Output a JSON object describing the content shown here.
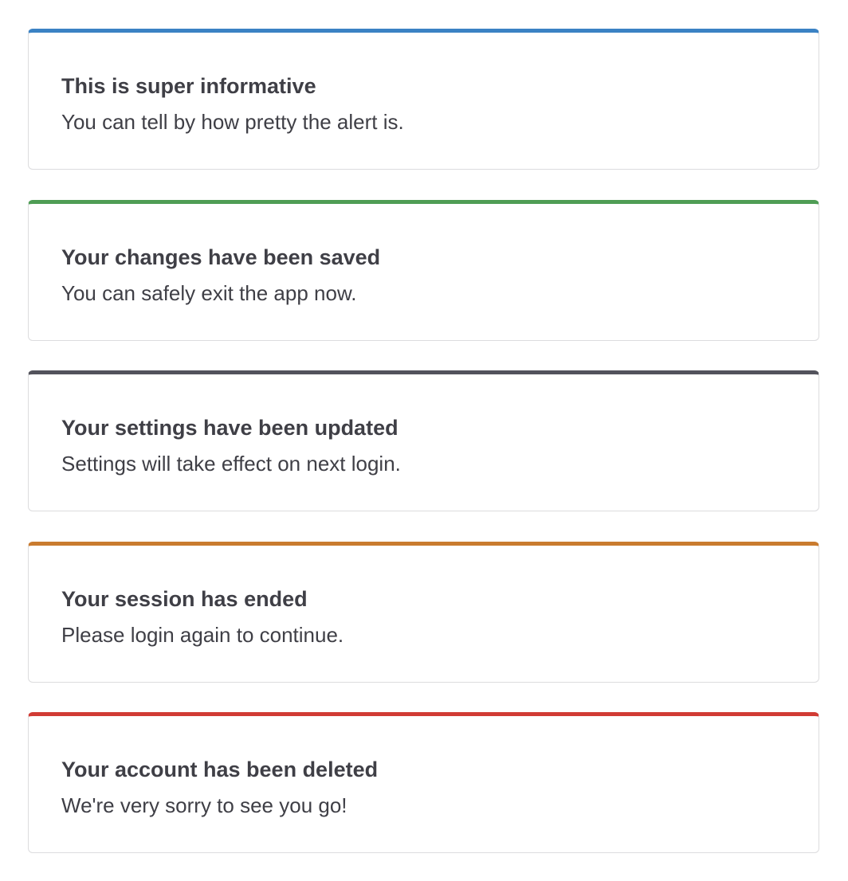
{
  "alerts": [
    {
      "variant": "info",
      "accent_color": "#3b82c4",
      "title": "This is super informative",
      "message": "You can tell by how pretty the alert is."
    },
    {
      "variant": "success",
      "accent_color": "#4f9d55",
      "title": "Your changes have been saved",
      "message": "You can safely exit the app now."
    },
    {
      "variant": "neutral",
      "accent_color": "#53535c",
      "title": "Your settings have been updated",
      "message": "Settings will take effect on next login."
    },
    {
      "variant": "warning",
      "accent_color": "#c97b2f",
      "title": "Your session has ended",
      "message": "Please login again to continue."
    },
    {
      "variant": "danger",
      "accent_color": "#d13b34",
      "title": "Your account has been deleted",
      "message": "We're very sorry to see you go!"
    }
  ]
}
